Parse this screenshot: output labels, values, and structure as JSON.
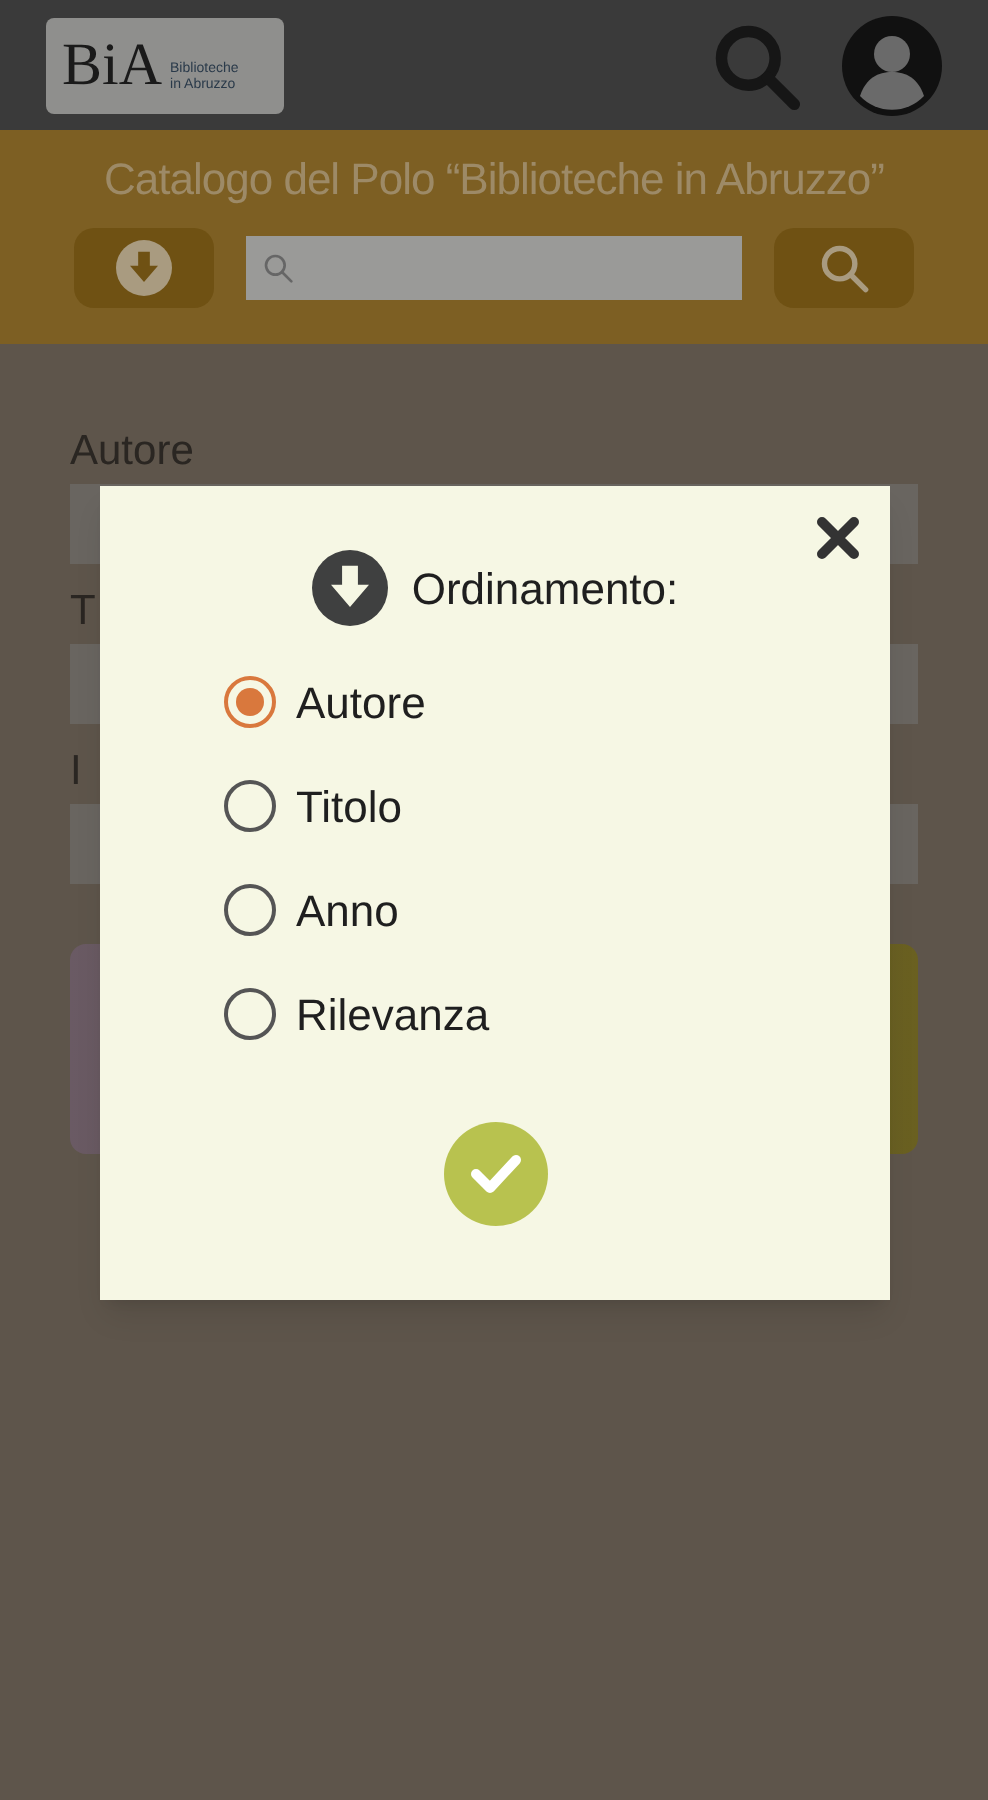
{
  "header": {
    "logo": {
      "letters": "BiA",
      "subtitle": "Biblioteche in Abruzzo"
    }
  },
  "banner": {
    "title": "Catalogo del Polo “Biblioteche in Abruzzo”"
  },
  "form": {
    "fields": [
      {
        "label": "Autore"
      },
      {
        "label": "T"
      },
      {
        "label": "I"
      }
    ]
  },
  "dialog": {
    "title": "Ordinamento:",
    "options": [
      {
        "label": "Autore",
        "selected": true
      },
      {
        "label": "Titolo",
        "selected": false
      },
      {
        "label": "Anno",
        "selected": false
      },
      {
        "label": "Rilevanza",
        "selected": false
      }
    ]
  }
}
